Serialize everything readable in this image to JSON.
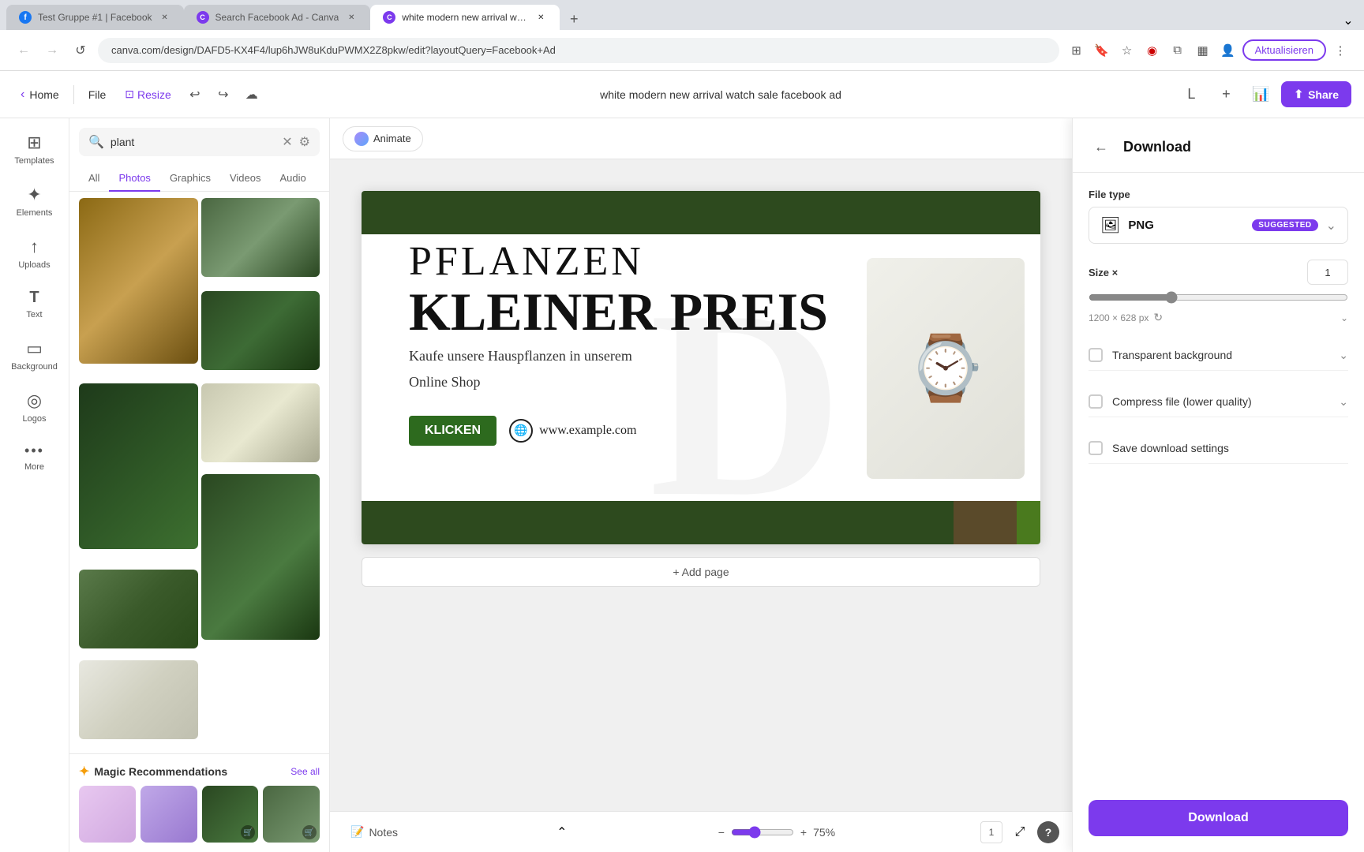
{
  "browser": {
    "tabs": [
      {
        "id": "tab1",
        "title": "Test Gruppe #1 | Facebook",
        "favicon": "fb",
        "active": false
      },
      {
        "id": "tab2",
        "title": "Search Facebook Ad - Canva",
        "favicon": "canva",
        "active": false
      },
      {
        "id": "tab3",
        "title": "white modern new arrival watc...",
        "favicon": "canva",
        "active": true
      }
    ],
    "address": "canva.com/design/DAFD5-KX4F4/lup6hJW8uKduPWMX2Z8pkw/edit?layoutQuery=Facebook+Ad",
    "aktualisieren_label": "Aktualisieren"
  },
  "header": {
    "home_label": "Home",
    "file_label": "File",
    "resize_label": "Resize",
    "doc_title": "white modern new arrival watch sale facebook ad",
    "share_label": "Share"
  },
  "sidebar": {
    "items": [
      {
        "id": "templates",
        "label": "Templates",
        "icon": "⊞"
      },
      {
        "id": "elements",
        "label": "Elements",
        "icon": "✦"
      },
      {
        "id": "uploads",
        "label": "Uploads",
        "icon": "↑"
      },
      {
        "id": "text",
        "label": "Text",
        "icon": "T"
      },
      {
        "id": "background",
        "label": "Background",
        "icon": "▭"
      },
      {
        "id": "logos",
        "label": "Logos",
        "icon": "◎"
      },
      {
        "id": "more",
        "label": "More",
        "icon": "···"
      }
    ]
  },
  "search": {
    "placeholder": "plant",
    "clear_title": "Clear",
    "filter_title": "Filter",
    "tabs": [
      "All",
      "Photos",
      "Graphics",
      "Videos",
      "Audio"
    ],
    "active_tab": "Photos"
  },
  "magic": {
    "title": "Magic Recommendations",
    "see_all": "See all"
  },
  "canvas": {
    "animate_label": "Animate",
    "design": {
      "pflanzen": "PFLANZEN",
      "kleiner": "KLEINER PREIS",
      "subtitle": "Kaufe unsere Hauspflanzen in unserem",
      "subtitle2": "Online Shop",
      "button_label": "KLICKEN",
      "url": "www.example.com"
    },
    "add_page": "+ Add page",
    "zoom": "75%"
  },
  "download_panel": {
    "title": "Download",
    "back_title": "Back",
    "file_type_label": "File type",
    "file_type": "PNG",
    "suggested_badge": "SUGGESTED",
    "size_label": "Size ×",
    "size_value": "1",
    "dimension": "1200 × 628 px",
    "transparent_bg": "Transparent background",
    "compress_file": "Compress file (lower quality)",
    "save_settings": "Save download settings",
    "download_btn": "Download"
  },
  "footer": {
    "notes_label": "Notes",
    "zoom_value": "75%",
    "page_number": "1"
  }
}
